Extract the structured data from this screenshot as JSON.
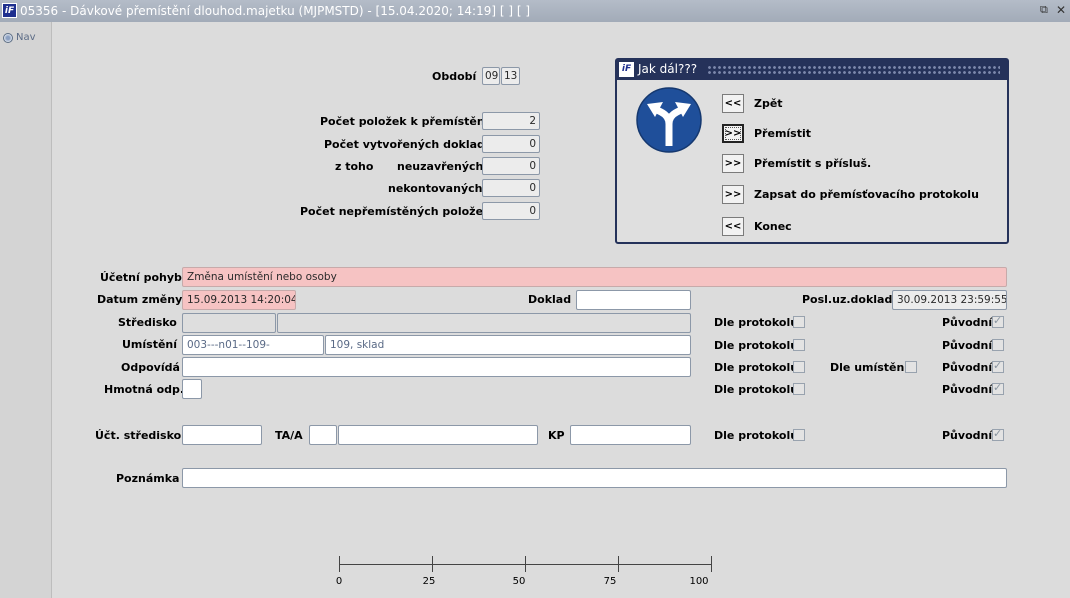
{
  "window": {
    "logo": "iF",
    "title": "05356 - Dávkové přemístění dlouhod.majetku (MJPMSTD) - [15.04.2020; 14:19]  [ ]  [ ]",
    "restore_icon": "restore-icon",
    "close_icon": "close-icon"
  },
  "nav": {
    "label": "Nav"
  },
  "obdobi": {
    "label": "Období",
    "month": "09",
    "year": "13"
  },
  "counts": {
    "pocet_polozek": {
      "label": "Počet položek k přemístění",
      "value": "2"
    },
    "pocet_dokladu": {
      "label": "Počet vytvořených dokladů",
      "value": "0"
    },
    "ztoho": {
      "label": "z toho",
      "label2": "neuzavřených",
      "value": "0"
    },
    "nekontovanych": {
      "label": "nekontovaných",
      "value": "0"
    },
    "neprem": {
      "label": "Počet nepřemístěných položek",
      "value": "0"
    }
  },
  "dialog": {
    "logo": "iF",
    "title": "Jak dál???",
    "sign_icon": "split-arrow-sign-icon",
    "items": [
      {
        "btn": "<<",
        "label": "Zpět"
      },
      {
        "btn": ">>",
        "label": "Přemístit"
      },
      {
        "btn": ">>",
        "label": "Přemístit s přísluš."
      },
      {
        "btn": ">>",
        "label": "Zapsat do přemísťovacího protokolu"
      },
      {
        "btn": "<<",
        "label": "Konec"
      }
    ]
  },
  "form": {
    "ucetni_pohyb": {
      "label": "Účetní pohyb",
      "value": "Změna umístění nebo osoby"
    },
    "datum_zmeny": {
      "label": "Datum změny",
      "value": "15.09.2013 14:20:04"
    },
    "doklad": {
      "label": "Doklad",
      "value": ""
    },
    "posl_uz_doklad": {
      "label": "Posl.uz.doklad",
      "value": "30.09.2013 23:59:55"
    },
    "stredisko": {
      "label": "Středisko",
      "code": "",
      "name": ""
    },
    "umisteni": {
      "label": "Umístění",
      "code": "003---n01--109-",
      "name": "109, sklad"
    },
    "odpovida": {
      "label": "Odpovídá",
      "value": ""
    },
    "hmotna_odp": {
      "label": "Hmotná odp.",
      "value": ""
    },
    "uct_stredisko": {
      "label": "Účt. středisko",
      "value": ""
    },
    "taa": {
      "label": "TA/A",
      "code": "",
      "name": ""
    },
    "kp": {
      "label": "KP",
      "value": ""
    },
    "poznamka": {
      "label": "Poznámka",
      "value": ""
    },
    "dle_protokolu": "Dle protokolu",
    "dle_umisteni": "Dle umístění",
    "puvodni": "Původní"
  },
  "ruler": {
    "ticks": [
      "0",
      "25",
      "50",
      "75",
      "100"
    ]
  }
}
